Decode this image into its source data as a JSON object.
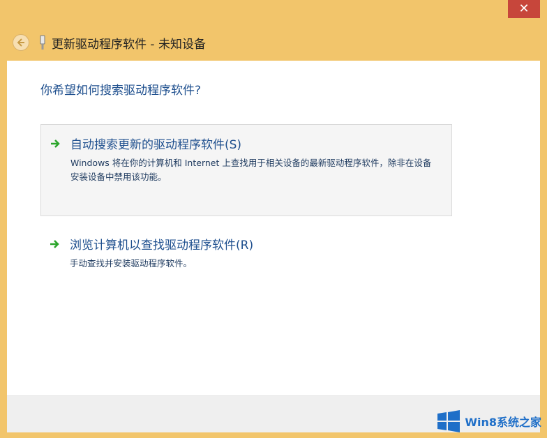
{
  "window": {
    "title": "更新驱动程序软件 - 未知设备",
    "close_glyph": "✕",
    "colors": {
      "frame": "#f2c56b",
      "close": "#c7463b",
      "accent": "#1e4f8e",
      "arrow": "#2aa52a"
    }
  },
  "main": {
    "question": "你希望如何搜索驱动程序软件?",
    "options": [
      {
        "title": "自动搜索更新的驱动程序软件(S)",
        "description": "Windows 将在你的计算机和 Internet 上查找用于相关设备的最新驱动程序软件，除非在设备安装设备中禁用该功能。"
      },
      {
        "title": "浏览计算机以查找驱动程序软件(R)",
        "description": "手动查找并安装驱动程序软件。"
      }
    ]
  },
  "watermark": {
    "text": "Win8系统之家",
    "logo": "windows-logo"
  }
}
